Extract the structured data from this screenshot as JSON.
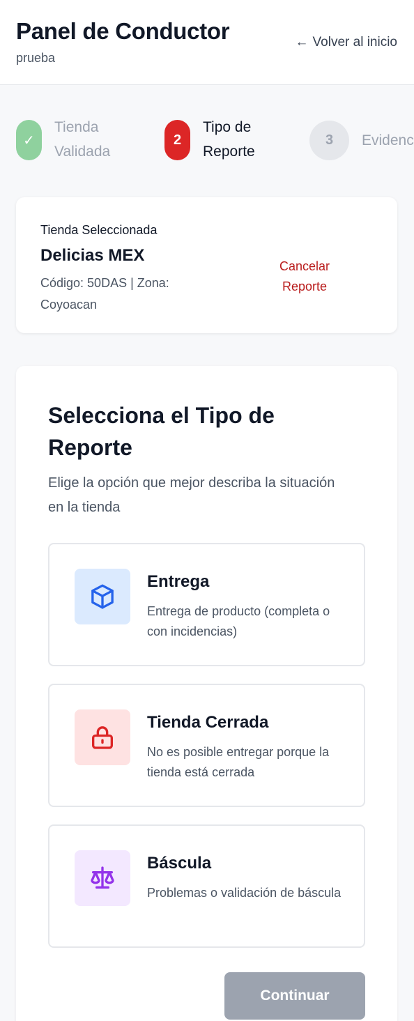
{
  "header": {
    "title": "Panel de Conductor",
    "subtitle": "prueba",
    "back_label": "Volver al inicio",
    "back_arrow": "←"
  },
  "steps": [
    {
      "marker": "✓",
      "label": "Tienda Validada",
      "state": "done"
    },
    {
      "marker": "2",
      "label": "Tipo de Reporte",
      "state": "active"
    },
    {
      "marker": "3",
      "label": "Evidencia",
      "state": "pending"
    }
  ],
  "store": {
    "label": "Tienda Seleccionada",
    "name": "Delicias MEX",
    "meta": "Código: 50DAS | Zona: Coyoacan",
    "cancel_label": "Cancelar Reporte"
  },
  "report": {
    "title": "Selecciona el Tipo de Reporte",
    "subtitle": "Elige la opción que mejor describa la situación en la tienda",
    "options": [
      {
        "icon": "box-icon",
        "title": "Entrega",
        "description": "Entrega de producto (completa o con incidencias)",
        "color": "#2563eb",
        "bg": "#dbeafe"
      },
      {
        "icon": "lock-icon",
        "title": "Tienda Cerrada",
        "description": "No es posible entregar porque la tienda está cerrada",
        "color": "#dc2626",
        "bg": "#fee2e2"
      },
      {
        "icon": "scale-icon",
        "title": "Báscula",
        "description": "Problemas o validación de báscula",
        "color": "#9333ea",
        "bg": "#f3e8ff"
      }
    ],
    "continue_label": "Continuar"
  },
  "colors": {
    "accent": "#dc2626",
    "done": "#8fd19e",
    "disabled": "#9ca3af"
  }
}
